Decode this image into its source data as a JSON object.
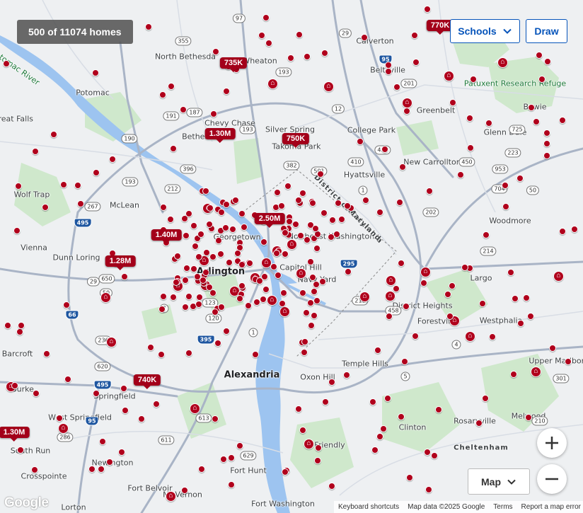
{
  "header": {
    "result_count": "500 of 11074 homes",
    "schools_label": "Schools",
    "draw_label": "Draw"
  },
  "controls": {
    "zoom_in": "+",
    "zoom_out": "−",
    "map_type": "Map"
  },
  "attribution": {
    "logo": "Google",
    "shortcuts": "Keyboard shortcuts",
    "map_data": "Map data ©2025 Google",
    "terms": "Terms",
    "report": "Report a map error"
  },
  "colors": {
    "marker": "#b0001c",
    "price_tag": "#a3001a",
    "accent_blue": "#0654ba",
    "water": "#9dc4f0",
    "park": "#c8e6c4"
  },
  "place_labels": [
    {
      "text": "Arlington",
      "cls": "big"
    },
    {
      "text": "Alexandria",
      "cls": "big"
    },
    {
      "text": "North Bethesda",
      "cls": ""
    },
    {
      "text": "Potomac",
      "cls": ""
    },
    {
      "text": "Great Falls",
      "cls": ""
    },
    {
      "text": "Wolf Trap",
      "cls": ""
    },
    {
      "text": "McLean",
      "cls": ""
    },
    {
      "text": "Vienna",
      "cls": ""
    },
    {
      "text": "Dunn Loring",
      "cls": ""
    },
    {
      "text": "Chevy Chase",
      "cls": ""
    },
    {
      "text": "Silver Spring",
      "cls": ""
    },
    {
      "text": "Takoma Park",
      "cls": ""
    },
    {
      "text": "College Park",
      "cls": ""
    },
    {
      "text": "Greenbelt",
      "cls": ""
    },
    {
      "text": "Beltsville",
      "cls": ""
    },
    {
      "text": "Calverton",
      "cls": ""
    },
    {
      "text": "Hyattsville",
      "cls": ""
    },
    {
      "text": "New Carrollton",
      "cls": ""
    },
    {
      "text": "Glenn Dale",
      "cls": ""
    },
    {
      "text": "Bowie",
      "cls": ""
    },
    {
      "text": "Woodmore",
      "cls": ""
    },
    {
      "text": "Largo",
      "cls": ""
    },
    {
      "text": "District Heights",
      "cls": ""
    },
    {
      "text": "Forestville",
      "cls": ""
    },
    {
      "text": "Westphalia",
      "cls": ""
    },
    {
      "text": "Upper Marlboro",
      "cls": ""
    },
    {
      "text": "Temple Hills",
      "cls": ""
    },
    {
      "text": "Oxon Hill",
      "cls": ""
    },
    {
      "text": "Clinton",
      "cls": ""
    },
    {
      "text": "Rosaryville",
      "cls": ""
    },
    {
      "text": "Melwood",
      "cls": ""
    },
    {
      "text": "Friendly",
      "cls": ""
    },
    {
      "text": "Fort Hunt",
      "cls": ""
    },
    {
      "text": "Fort Washington",
      "cls": ""
    },
    {
      "text": "Mt Vernon",
      "cls": ""
    },
    {
      "text": "Fort Belvoir",
      "cls": ""
    },
    {
      "text": "Newington",
      "cls": ""
    },
    {
      "text": "Lorton",
      "cls": ""
    },
    {
      "text": "Crosspointe",
      "cls": ""
    },
    {
      "text": "South Run",
      "cls": ""
    },
    {
      "text": "West Springfield",
      "cls": ""
    },
    {
      "text": "Springfield",
      "cls": ""
    },
    {
      "text": "Burke",
      "cls": ""
    },
    {
      "text": "Lake Barcroft",
      "cls": ""
    },
    {
      "text": "Capitol Hill",
      "cls": ""
    },
    {
      "text": "Navy Yard",
      "cls": ""
    },
    {
      "text": "Northeast Washington",
      "cls": ""
    },
    {
      "text": "Georgetown",
      "cls": ""
    },
    {
      "text": "Bethesda",
      "cls": ""
    },
    {
      "text": "Wheaton",
      "cls": ""
    },
    {
      "text": "Patuxent Research Refuge",
      "cls": "area"
    },
    {
      "text": "District of Columbia",
      "cls": "dc"
    },
    {
      "text": "Maryland",
      "cls": "dc"
    },
    {
      "text": "Cheltenham",
      "cls": "dc"
    },
    {
      "text": "Potomac River",
      "cls": "area"
    }
  ],
  "route_shields": [
    "355",
    "97",
    "29",
    "95",
    "193",
    "201",
    "187",
    "191",
    "190",
    "410",
    "501",
    "1",
    "450",
    "50",
    "202",
    "214",
    "295",
    "218",
    "458",
    "4",
    "5",
    "395",
    "66",
    "29",
    "7",
    "50",
    "236",
    "620",
    "495",
    "95",
    "286",
    "611",
    "613",
    "629",
    "1",
    "210",
    "301",
    "193",
    "267",
    "495",
    "123",
    "650",
    "120",
    "396",
    "212",
    "193",
    "953",
    "704",
    "223",
    "725",
    "414",
    "12",
    "382"
  ],
  "price_tags": [
    "770K",
    "735K",
    "1.30M",
    "750K",
    "2.50M",
    "1.40M",
    "1.28M",
    "740K",
    "1.30M"
  ],
  "listing_markers": {
    "count_plotted": 320,
    "home_icon_count": 32
  }
}
